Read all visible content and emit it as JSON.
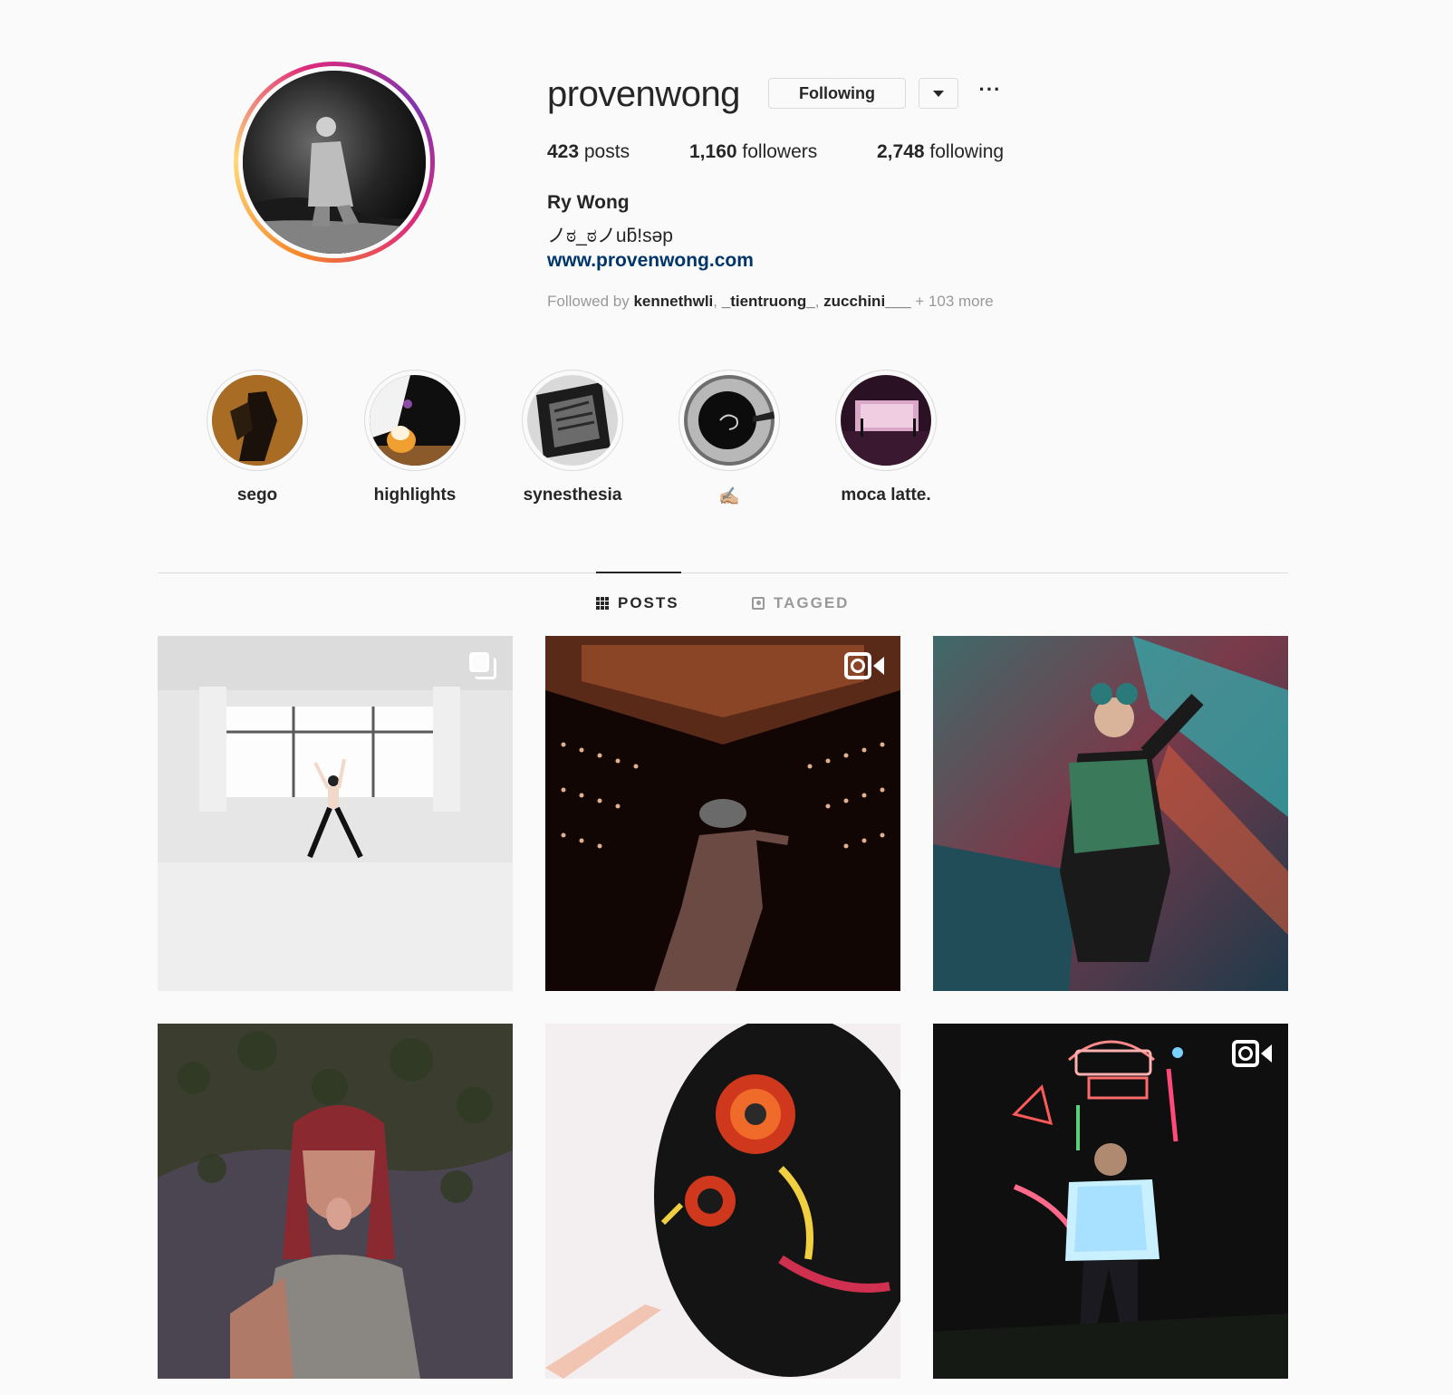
{
  "profile": {
    "username": "provenwong",
    "following_label": "Following",
    "more_label": "···",
    "stats": {
      "posts_count": "423",
      "posts_label": " posts",
      "followers_count": "1,160",
      "followers_label": " followers",
      "following_count": "2,748",
      "following_label": " following"
    },
    "full_name": "Ry Wong",
    "bio": "ノಠ_ಠノuƃ!sǝp",
    "website": "www.provenwong.com",
    "followed_by": {
      "prefix": "Followed by ",
      "names": [
        "kennethwli",
        "_tientruong_",
        "zucchini___"
      ],
      "suffix": " + 103 more"
    }
  },
  "highlights": [
    {
      "label": "sego",
      "icon": "saxophone-photo"
    },
    {
      "label": "highlights",
      "icon": "flower-photo"
    },
    {
      "label": "synesthesia",
      "icon": "tile-photo"
    },
    {
      "label": "✍🏼",
      "icon": "spiral-photo"
    },
    {
      "label": "moca latte.",
      "icon": "gallery-photo"
    }
  ],
  "tabs": {
    "posts": "POSTS",
    "tagged": "TAGGED"
  },
  "posts": [
    {
      "type": "carousel",
      "icon": "carousel-icon"
    },
    {
      "type": "video",
      "icon": "video-icon"
    },
    {
      "type": "photo",
      "icon": ""
    },
    {
      "type": "photo",
      "icon": ""
    },
    {
      "type": "photo",
      "icon": ""
    },
    {
      "type": "video",
      "icon": "video-icon"
    }
  ],
  "colors": {
    "background": "#fafafa",
    "link": "#003569",
    "muted": "#999999",
    "border": "#dbdbdb",
    "text": "#262626"
  }
}
